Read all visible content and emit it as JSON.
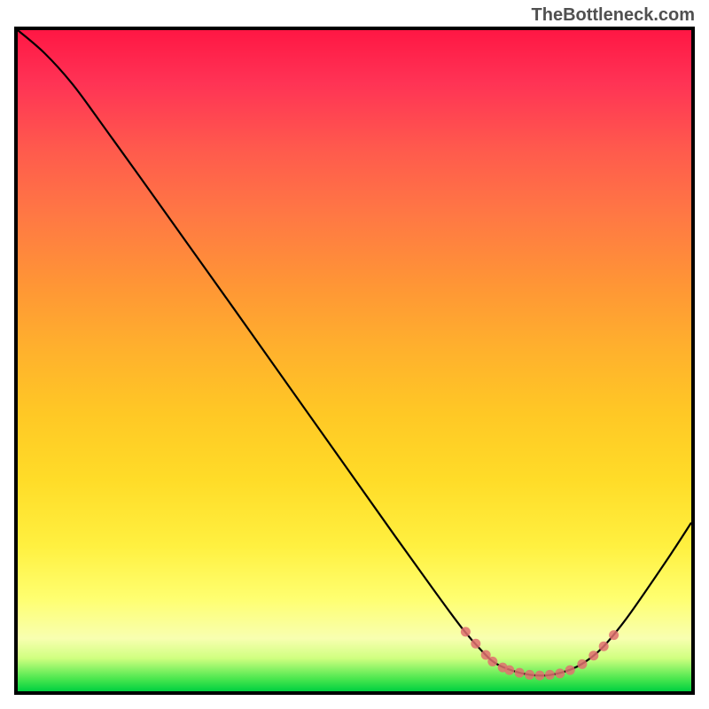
{
  "watermark": "TheBottleneck.com",
  "chart_data": {
    "type": "line",
    "title": "",
    "xlabel": "",
    "ylabel": "",
    "xlim": [
      0,
      100
    ],
    "ylim": [
      0,
      100
    ],
    "curve_points": [
      {
        "x": 0,
        "y": 100
      },
      {
        "x": 4,
        "y": 96.5
      },
      {
        "x": 8,
        "y": 92
      },
      {
        "x": 12,
        "y": 86.5
      },
      {
        "x": 18,
        "y": 78
      },
      {
        "x": 25,
        "y": 68
      },
      {
        "x": 32,
        "y": 58
      },
      {
        "x": 40,
        "y": 46.5
      },
      {
        "x": 48,
        "y": 35
      },
      {
        "x": 56,
        "y": 23.5
      },
      {
        "x": 62,
        "y": 15
      },
      {
        "x": 66,
        "y": 9.5
      },
      {
        "x": 69,
        "y": 6
      },
      {
        "x": 71,
        "y": 4.2
      },
      {
        "x": 73.5,
        "y": 3.1
      },
      {
        "x": 76,
        "y": 2.5
      },
      {
        "x": 78.5,
        "y": 2.4
      },
      {
        "x": 81,
        "y": 2.9
      },
      {
        "x": 83,
        "y": 3.7
      },
      {
        "x": 85,
        "y": 5
      },
      {
        "x": 87,
        "y": 6.8
      },
      {
        "x": 90,
        "y": 10.5
      },
      {
        "x": 93,
        "y": 14.8
      },
      {
        "x": 97,
        "y": 20.8
      },
      {
        "x": 100,
        "y": 25.5
      }
    ],
    "markers": [
      {
        "x": 66.5,
        "y": 9
      },
      {
        "x": 68,
        "y": 7.2
      },
      {
        "x": 69.5,
        "y": 5.5
      },
      {
        "x": 70.5,
        "y": 4.5
      },
      {
        "x": 72,
        "y": 3.6
      },
      {
        "x": 73,
        "y": 3.2
      },
      {
        "x": 74.5,
        "y": 2.8
      },
      {
        "x": 76,
        "y": 2.5
      },
      {
        "x": 77.5,
        "y": 2.4
      },
      {
        "x": 79,
        "y": 2.5
      },
      {
        "x": 80.5,
        "y": 2.7
      },
      {
        "x": 82,
        "y": 3.2
      },
      {
        "x": 83.8,
        "y": 4.1
      },
      {
        "x": 85.5,
        "y": 5.4
      },
      {
        "x": 87,
        "y": 6.8
      },
      {
        "x": 88.5,
        "y": 8.5
      }
    ]
  }
}
